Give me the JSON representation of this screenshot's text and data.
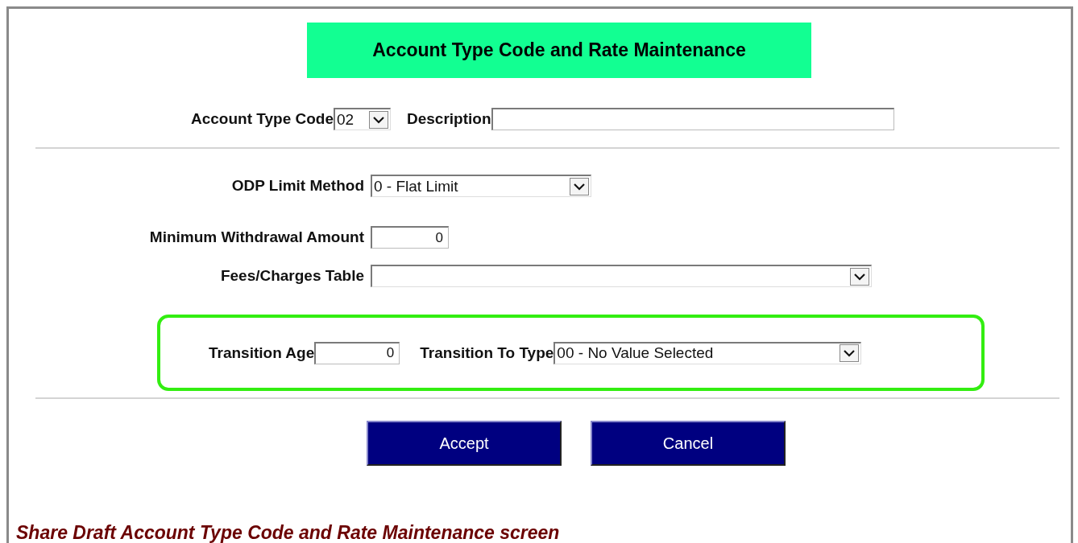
{
  "title": "Account Type Code and Rate Maintenance",
  "header_fields": [
    {
      "kind": "select",
      "label": "Account Type Code",
      "value": "02"
    },
    {
      "kind": "input",
      "label": "Description"
    }
  ],
  "fields": [
    {
      "kind": "select",
      "label": "ODP Limit Method",
      "value": "0 - Flat Limit"
    },
    {
      "kind": "input",
      "label": "Minimum Withdrawal Amount",
      "value": "0"
    },
    {
      "kind": "select",
      "label": "Fees/Charges Table"
    }
  ],
  "transition_fields": [
    {
      "kind": "input",
      "label": "Transition Age",
      "value": "0"
    },
    {
      "kind": "select",
      "label": "Transition To Type",
      "value": "00 - No Value Selected"
    }
  ],
  "buttons": [
    "Accept",
    "Cancel"
  ],
  "caption": "Share Draft Account Type Code and Rate Maintenance screen"
}
